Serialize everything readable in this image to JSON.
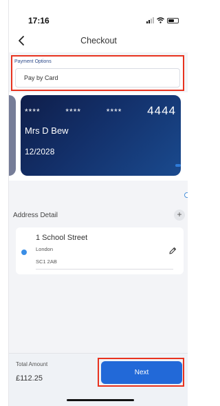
{
  "status_bar": {
    "time": "17:16",
    "icons": [
      "signal-icon",
      "wifi-icon",
      "battery-icon"
    ]
  },
  "header": {
    "title": "Checkout",
    "back_icon": "chevron-left-icon"
  },
  "payment": {
    "label": "Payment Options",
    "selected": "Pay by Card"
  },
  "card": {
    "mask_groups": [
      "****",
      "****",
      "****"
    ],
    "last4": "4444",
    "holder": "Mrs D Bew",
    "expiry": "12/2028"
  },
  "address": {
    "title": "Address Detail",
    "add_icon": "plus-icon",
    "line1": "1 School Street",
    "city": "London",
    "postcode": "SC1 2AB",
    "edit_icon": "pencil-icon"
  },
  "footer": {
    "total_label": "Total Amount",
    "total_value": "£112.25",
    "next_label": "Next"
  },
  "colors": {
    "accent": "#2269d8",
    "highlight": "#e8321e",
    "radio": "#3a8ee6"
  }
}
